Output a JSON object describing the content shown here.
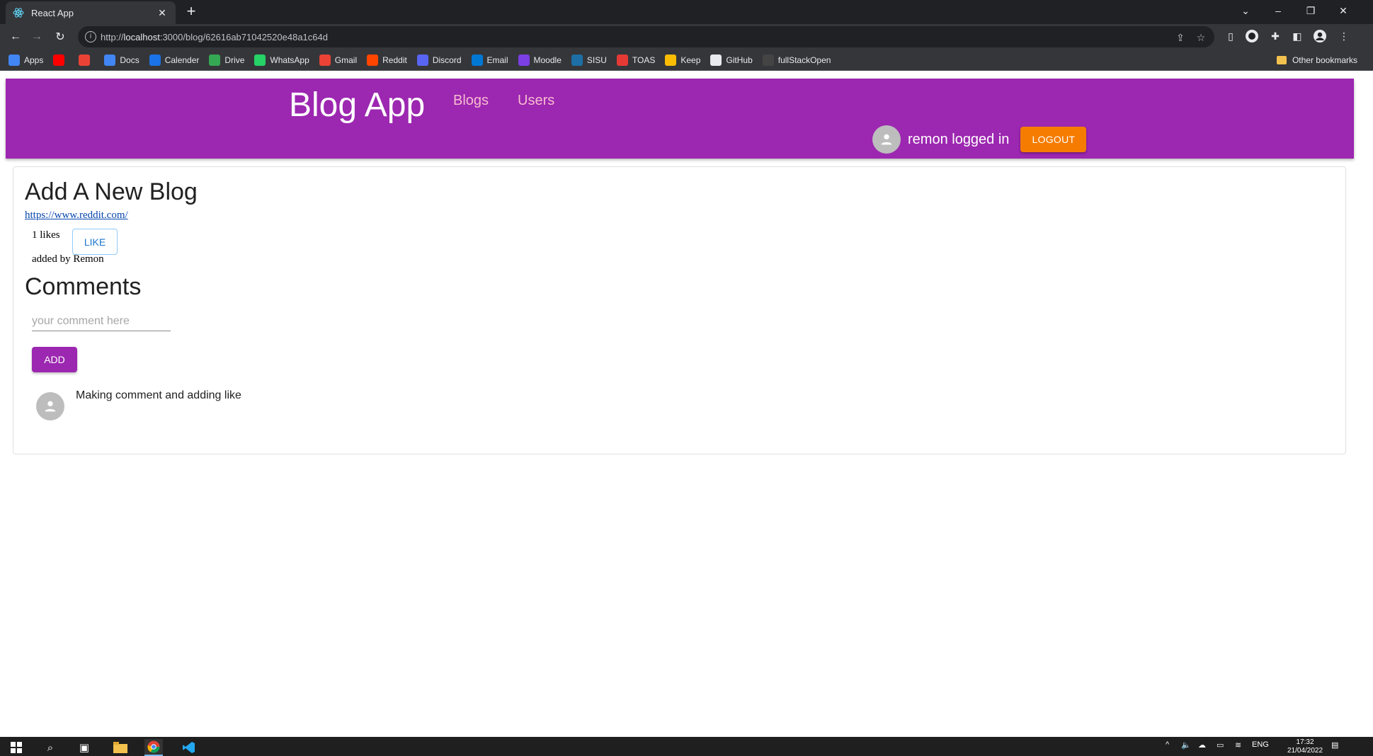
{
  "browser": {
    "tab_title": "React App",
    "url_prefix": "http://",
    "url_host": "localhost",
    "url_rest": ":3000/blog/62616ab71042520e48a1c64d"
  },
  "bookmarks": [
    {
      "label": "Apps",
      "icon": "apps-grid-icon",
      "color": "#4285f4"
    },
    {
      "label": "",
      "icon": "youtube-icon",
      "color": "#ff0000"
    },
    {
      "label": "",
      "icon": "gmail-icon",
      "color": "#ea4335"
    },
    {
      "label": "Docs",
      "icon": "docs-icon",
      "color": "#4285f4"
    },
    {
      "label": "Calender",
      "icon": "calendar-icon",
      "color": "#1a73e8"
    },
    {
      "label": "Drive",
      "icon": "drive-icon",
      "color": "#34a853"
    },
    {
      "label": "WhatsApp",
      "icon": "whatsapp-icon",
      "color": "#25d366"
    },
    {
      "label": "Gmail",
      "icon": "gmail-icon",
      "color": "#ea4335"
    },
    {
      "label": "Reddit",
      "icon": "reddit-icon",
      "color": "#ff4500"
    },
    {
      "label": "Discord",
      "icon": "discord-icon",
      "color": "#5865f2"
    },
    {
      "label": "Email",
      "icon": "outlook-icon",
      "color": "#0078d4"
    },
    {
      "label": "Moodle",
      "icon": "moodle-icon",
      "color": "#7b3fe4"
    },
    {
      "label": "SISU",
      "icon": "sisu-icon",
      "color": "#1d6fa5"
    },
    {
      "label": "TOAS",
      "icon": "toas-icon",
      "color": "#e53935"
    },
    {
      "label": "Keep",
      "icon": "keep-icon",
      "color": "#fbbc04"
    },
    {
      "label": "GitHub",
      "icon": "github-icon",
      "color": "#e8eaed"
    },
    {
      "label": "fullStackOpen",
      "icon": "fullstackopen-icon",
      "color": "#444444"
    }
  ],
  "other_bookmarks": "Other bookmarks",
  "app": {
    "brand": "Blog App",
    "nav": {
      "blogs": "Blogs",
      "users": "Users"
    },
    "user_status": "remon logged in",
    "logout": "LOGOUT",
    "accent": "#9c27b0",
    "logout_color": "#f57c00"
  },
  "blog": {
    "title": "Add A New Blog",
    "url": "https://www.reddit.com/",
    "likes": "1 likes",
    "like_button": "LIKE",
    "added_by": "added by Remon"
  },
  "comments": {
    "heading": "Comments",
    "placeholder": "your comment here",
    "add_button": "ADD",
    "items": [
      "Making comment and adding like"
    ]
  },
  "taskbar": {
    "language": "ENG",
    "time": "17:32",
    "date": "21/04/2022"
  }
}
